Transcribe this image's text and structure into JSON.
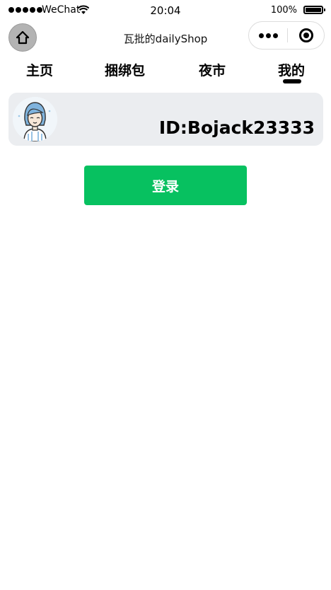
{
  "status_bar": {
    "carrier": "WeChat",
    "time": "20:04",
    "battery": "100%",
    "icons": [
      "signal-dots-icon",
      "wifi-icon",
      "battery-icon"
    ]
  },
  "nav_bar": {
    "title": "瓦批的dailyShop",
    "icons": [
      "home-icon",
      "more-icon",
      "target-icon"
    ]
  },
  "tabs": [
    {
      "label": "主页",
      "active": false
    },
    {
      "label": "捆绑包",
      "active": false
    },
    {
      "label": "夜市",
      "active": false
    },
    {
      "label": "我的",
      "active": true
    }
  ],
  "profile": {
    "user_id": "ID:Bojack23333",
    "avatar": "avatar-illustration"
  },
  "login": {
    "label": "登录"
  },
  "colors": {
    "accent": "#07c160",
    "card_bg": "#ebedf0",
    "home_button_bg": "#b3b3b3"
  }
}
